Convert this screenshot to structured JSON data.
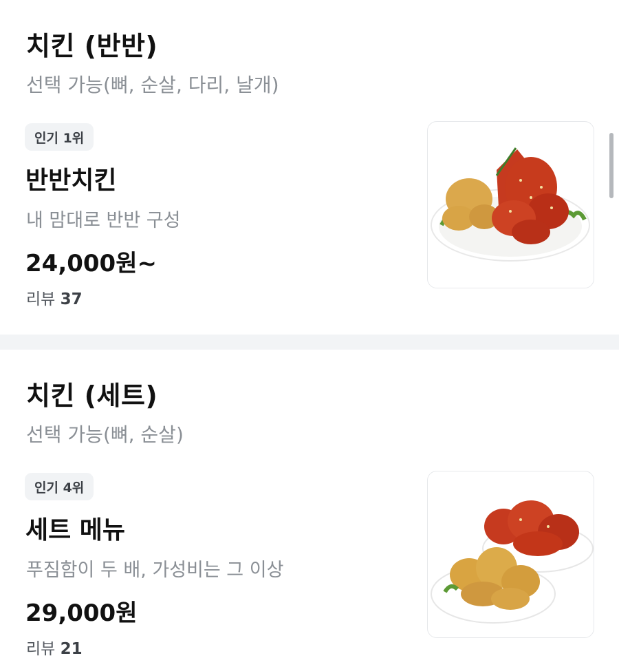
{
  "sections": [
    {
      "title": "치킨 (반반)",
      "subtitle": "선택 가능(뼈, 순살, 다리, 날개)",
      "item": {
        "badge": "인기 1위",
        "name": "반반치킨",
        "description": "내 맘대로 반반 구성",
        "price": "24,000원~",
        "review_label": "리뷰",
        "review_count": "37",
        "image": "half-half-chicken-photo"
      }
    },
    {
      "title": "치킨 (세트)",
      "subtitle": "선택 가능(뼈, 순살)",
      "item": {
        "badge": "인기 4위",
        "name": "세트 메뉴",
        "description": "푸짐함이 두 배, 가성비는 그 이상",
        "price": "29,000원",
        "review_label": "리뷰",
        "review_count": "21",
        "image": "set-chicken-photo"
      }
    }
  ],
  "colors": {
    "text_primary": "#111111",
    "text_secondary": "#8a8f95",
    "badge_bg": "#f1f3f5",
    "divider": "#f2f4f6",
    "sauce_red": "#c9351c",
    "fried_gold": "#d9a441"
  }
}
